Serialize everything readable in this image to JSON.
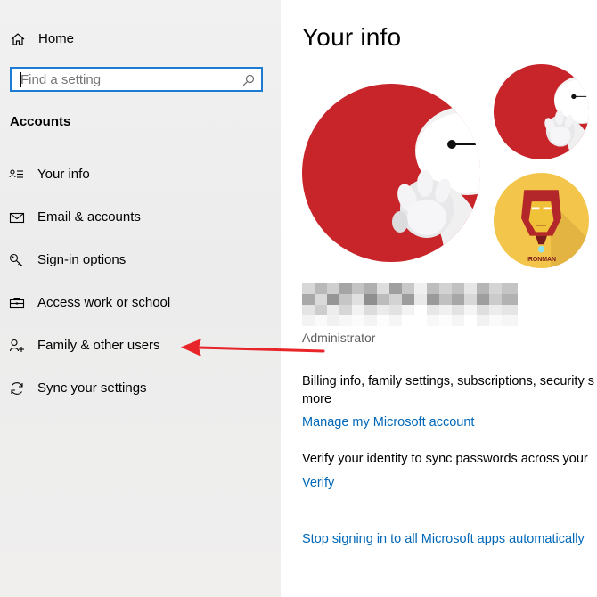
{
  "sidebar": {
    "home_label": "Home",
    "search_placeholder": "Find a setting",
    "section_title": "Accounts",
    "items": [
      {
        "label": "Your info",
        "icon": "contact-card-icon"
      },
      {
        "label": "Email & accounts",
        "icon": "mail-icon"
      },
      {
        "label": "Sign-in options",
        "icon": "key-icon"
      },
      {
        "label": "Access work or school",
        "icon": "briefcase-icon"
      },
      {
        "label": "Family & other users",
        "icon": "add-person-icon"
      },
      {
        "label": "Sync your settings",
        "icon": "sync-icon"
      }
    ]
  },
  "main": {
    "title": "Your info",
    "role": "Administrator",
    "billing_line1": "Billing info, family settings, subscriptions, security s",
    "billing_line2": "more",
    "manage_link": "Manage my Microsoft account",
    "verify_text": "Verify your identity to sync passwords across your",
    "verify_link": "Verify",
    "stop_link": "Stop signing in to all Microsoft apps automatically",
    "avatar2_caption": "IRONMAN"
  },
  "colors": {
    "accent": "#0067b8",
    "search_border": "#1e7bd2",
    "avatar_red": "#c8252b",
    "avatar_yellow": "#f3c64b",
    "annotation_arrow": "#e8262a"
  }
}
